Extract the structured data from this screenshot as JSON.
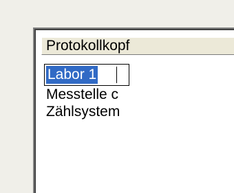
{
  "list": {
    "header": "Protokollkopf",
    "edit_value": "Labor 1",
    "items": [
      {
        "label": "Messtelle c"
      },
      {
        "label": "Zählsystem"
      }
    ]
  },
  "colors": {
    "selection": "#316ac5",
    "background": "#f0efe9",
    "list_background": "#ffffff"
  }
}
